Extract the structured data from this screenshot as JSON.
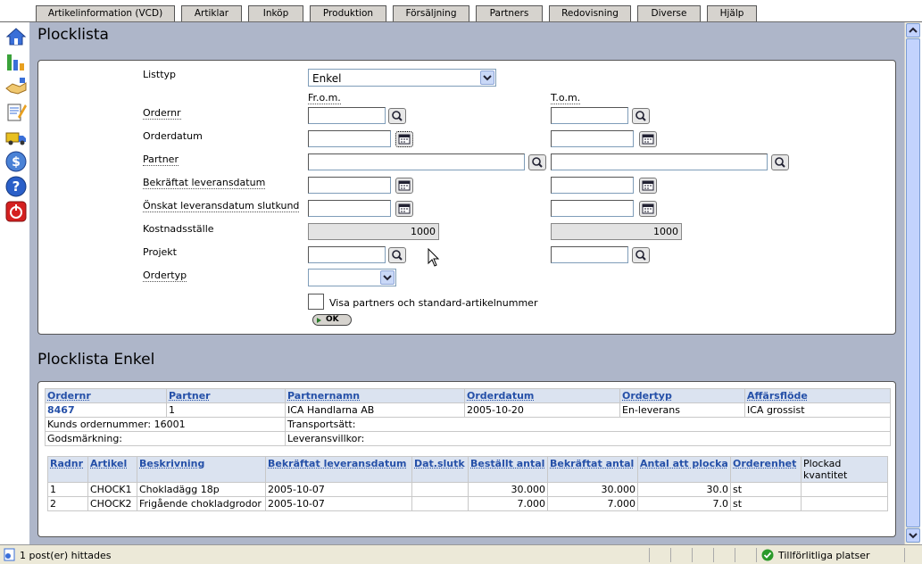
{
  "tabs": [
    "Artikelinformation (VCD)",
    "Artiklar",
    "Inköp",
    "Produktion",
    "Försäljning",
    "Partners",
    "Redovisning",
    "Diverse",
    "Hjälp"
  ],
  "left_icons": [
    "home-icon",
    "chart-icon",
    "handshake-icon",
    "document-edit-icon",
    "truck-icon",
    "dollar-icon",
    "help-icon",
    "power-icon"
  ],
  "form": {
    "title": "Plocklista",
    "listtyp_label": "Listtyp",
    "listtyp_value": "Enkel",
    "from_label": "Fr.o.m.",
    "to_label": "T.o.m.",
    "ordernr_label": "Ordernr",
    "orderdatum_label": "Orderdatum",
    "partner_label": "Partner",
    "bekraftat_label": "Bekräftat leveransdatum",
    "onskat_label": "Önskat leveransdatum slutkund",
    "kostnad_label": "Kostnadsställe",
    "kostnad_from": "1000",
    "kostnad_to": "1000",
    "projekt_label": "Projekt",
    "ordertyp_label": "Ordertyp",
    "checkbox_label": "Visa partners och standard-artikelnummer",
    "ok_label": "OK"
  },
  "result": {
    "title": "Plocklista Enkel",
    "header_cols": [
      "Ordernr",
      "Partner",
      "Partnernamn",
      "Orderdatum",
      "Ordertyp",
      "Affärsflöde"
    ],
    "order": {
      "ordernr": "8467",
      "partner": "1",
      "partnernamn": "ICA Handlarna AB",
      "orderdatum": "2005-10-20",
      "ordertyp": "En-leverans",
      "affarsflode": "ICA grossist"
    },
    "kunds_ordernummer": "Kunds ordernummer: 16001",
    "transportsatt": "Transportsätt:",
    "godsmarkning": "Godsmärkning:",
    "leveransvillkor": "Leveransvillkor:",
    "line_cols": [
      "Radnr",
      "Artikel",
      "Beskrivning",
      "Bekräftat leveransdatum",
      "Dat.slutk",
      "Beställt antal",
      "Bekräftat antal",
      "Antal att plocka",
      "Orderenhet",
      "Plockad kvantitet"
    ],
    "lines": [
      [
        "1",
        "CHOCK1",
        "Chokladägg 18p",
        "2005-10-07",
        "",
        "30.000",
        "30.000",
        "30.0",
        "st",
        ""
      ],
      [
        "2",
        "CHOCK2",
        "Frigående chokladgrodor",
        "2005-10-07",
        "",
        "7.000",
        "7.000",
        "7.0",
        "st",
        ""
      ]
    ]
  },
  "status": {
    "text": "1 post(er) hittades",
    "zone": "Tillförlitliga platser"
  }
}
